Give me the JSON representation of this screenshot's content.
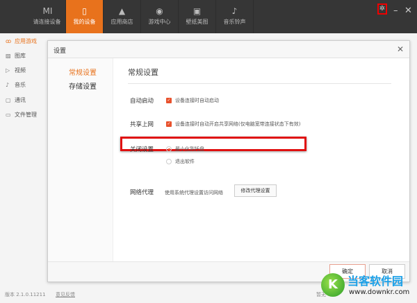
{
  "topbar": {
    "tabs": [
      {
        "label": "请连接设备",
        "icon": "mi-logo-icon",
        "glyph": "MI"
      },
      {
        "label": "我的设备",
        "icon": "phone-icon",
        "glyph": "▯"
      },
      {
        "label": "应用商店",
        "icon": "bag-icon",
        "glyph": "▲"
      },
      {
        "label": "游戏中心",
        "icon": "gamepad-icon",
        "glyph": "◉"
      },
      {
        "label": "壁纸美图",
        "icon": "picture-icon",
        "glyph": "▣"
      },
      {
        "label": "音乐铃声",
        "icon": "music-note-icon",
        "glyph": "♪"
      }
    ],
    "active_tab": 1,
    "settings_glyph": "✲",
    "minimize_glyph": "–",
    "close_glyph": "✕"
  },
  "sidebar": {
    "items": [
      {
        "label": "应用游戏",
        "glyph": "ꝏ"
      },
      {
        "label": "图库",
        "glyph": "▨"
      },
      {
        "label": "视频",
        "glyph": "▷"
      },
      {
        "label": "音乐",
        "glyph": "♪"
      },
      {
        "label": "通讯",
        "glyph": "▢"
      },
      {
        "label": "文件管理",
        "glyph": "▭"
      }
    ]
  },
  "dialog": {
    "title": "设置",
    "close_glyph": "✕",
    "nav": [
      "常规设置",
      "存储设置"
    ],
    "heading": "常规设置",
    "auto_start": {
      "label": "自动启动",
      "option": "设备连接时自动启动",
      "checked": true
    },
    "share_net": {
      "label": "共享上网",
      "option": "设备连接时自动开启共享网络(仅电脑宽带连接状态下有效)",
      "checked": true
    },
    "close": {
      "label": "关闭设置",
      "options": [
        "最小化到托盘",
        "退出软件"
      ],
      "selected": 0
    },
    "proxy": {
      "label": "网络代理",
      "text": "使用系统代理设置访问网络",
      "button": "修改代理设置"
    },
    "ok": "确定",
    "cancel": "取消"
  },
  "status": {
    "version": "版本 2.1.0.11211",
    "feedback": "意见反馈",
    "right_text": "暂无"
  },
  "watermark": {
    "name": "当客软件园",
    "url": "www.downkr.com"
  }
}
